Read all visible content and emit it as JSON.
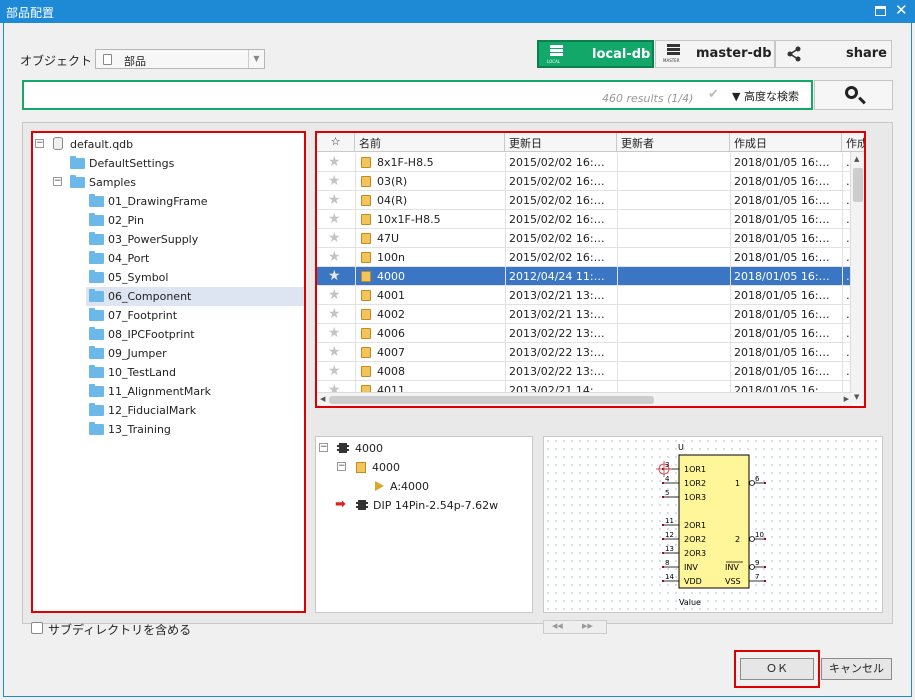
{
  "window": {
    "title": "部品配置",
    "maximize_icon": "maximize-icon",
    "close_icon": "close-icon"
  },
  "object_selector": {
    "label": "オブジェクト",
    "value": "部品"
  },
  "db_buttons": [
    {
      "name": "local-db",
      "caption": "LOCAL",
      "active": true
    },
    {
      "name": "master-db",
      "caption": "MASTER",
      "active": false
    },
    {
      "name": "share",
      "caption": "",
      "active": false
    }
  ],
  "search": {
    "value": "",
    "results": "460 results (1/4)",
    "advanced_label": "▼ 高度な検索",
    "accent": "#12a86a"
  },
  "tree": {
    "root": "default.qdb",
    "children": [
      {
        "label": "DefaultSettings"
      },
      {
        "label": "Samples",
        "children": [
          "01_DrawingFrame",
          "02_Pin",
          "03_PowerSupply",
          "04_Port",
          "05_Symbol",
          "06_Component",
          "07_Footprint",
          "08_IPCFootprint",
          "09_Jumper",
          "10_TestLand",
          "11_AlignmentMark",
          "12_FiducialMark",
          "13_Training"
        ]
      }
    ],
    "selected": "06_Component"
  },
  "grid": {
    "columns": [
      "☆",
      "名前",
      "更新日",
      "更新者",
      "作成日",
      "作成"
    ],
    "rows": [
      {
        "name": "8x1F-H8.5",
        "updated": "2015/02/02 16:…",
        "updater": "",
        "created": "2018/01/05 16:…",
        "extra": "…"
      },
      {
        "name": "03(R)",
        "updated": "2015/02/02 16:…",
        "updater": "",
        "created": "2018/01/05 16:…",
        "extra": "…"
      },
      {
        "name": "04(R)",
        "updated": "2015/02/02 16:…",
        "updater": "",
        "created": "2018/01/05 16:…",
        "extra": "…"
      },
      {
        "name": "10x1F-H8.5",
        "updated": "2015/02/02 16:…",
        "updater": "",
        "created": "2018/01/05 16:…",
        "extra": "…"
      },
      {
        "name": "47U",
        "updated": "2015/02/02 16:…",
        "updater": "",
        "created": "2018/01/05 16:…",
        "extra": "…"
      },
      {
        "name": "100n",
        "updated": "2015/02/02 16:…",
        "updater": "",
        "created": "2018/01/05 16:…",
        "extra": "…"
      },
      {
        "name": "4000",
        "updated": "2012/04/24 11:…",
        "updater": "",
        "created": "2018/01/05 16:…",
        "extra": "…",
        "selected": true
      },
      {
        "name": "4001",
        "updated": "2013/02/21 13:…",
        "updater": "",
        "created": "2018/01/05 16:…",
        "extra": "…"
      },
      {
        "name": "4002",
        "updated": "2013/02/21 13:…",
        "updater": "",
        "created": "2018/01/05 16:…",
        "extra": "…"
      },
      {
        "name": "4006",
        "updated": "2013/02/22 13:…",
        "updater": "",
        "created": "2018/01/05 16:…",
        "extra": "…"
      },
      {
        "name": "4007",
        "updated": "2013/02/22 13:…",
        "updater": "",
        "created": "2018/01/05 16:…",
        "extra": "…"
      },
      {
        "name": "4008",
        "updated": "2013/02/22 13:…",
        "updater": "",
        "created": "2018/01/05 16:…",
        "extra": "…"
      },
      {
        "name": "4011",
        "updated": "2013/02/21 14:…",
        "updater": "",
        "created": "2018/01/05 16:…",
        "extra": "…"
      }
    ]
  },
  "detail_tree": [
    {
      "label": "4000"
    },
    {
      "label": "4000"
    },
    {
      "label": "A:4000"
    },
    {
      "label": "DIP 14Pin-2.54p-7.62w"
    }
  ],
  "schematic": {
    "ref": "U",
    "value": "Value",
    "left_pins": [
      {
        "num": "3",
        "label": "1OR1"
      },
      {
        "num": "4",
        "label": "1OR2"
      },
      {
        "num": "5",
        "label": "1OR3"
      },
      {
        "num": "11",
        "label": "2OR1"
      },
      {
        "num": "12",
        "label": "2OR2"
      },
      {
        "num": "13",
        "label": "2OR3"
      },
      {
        "num": "8",
        "label": "INV"
      },
      {
        "num": "14",
        "label": "VDD"
      }
    ],
    "right_pins": [
      {
        "num": "6",
        "label": "1"
      },
      {
        "num": "10",
        "label": "2"
      },
      {
        "num": "9",
        "label": "INV"
      },
      {
        "num": "7",
        "label": "VSS"
      }
    ]
  },
  "options": {
    "include_subdirs_label": "サブディレクトリを含める"
  },
  "actions": {
    "ok_label": "ＯＫ",
    "cancel_label": "キャンセル"
  }
}
